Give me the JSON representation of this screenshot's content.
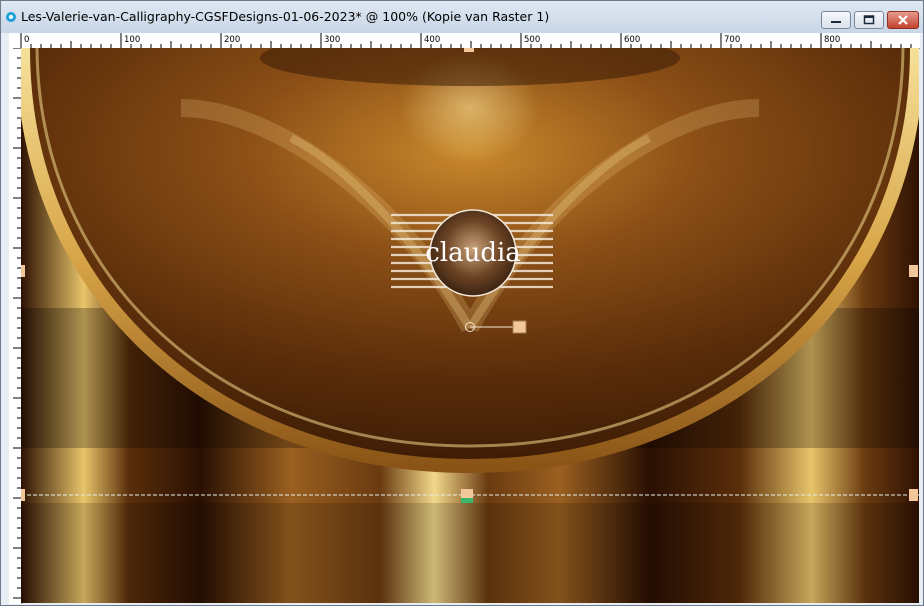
{
  "window": {
    "title": "Les-Valerie-van-Calligraphy-CGSFDesigns-01-06-2023* @ 100% (Kopie van Raster 1)"
  },
  "ruler": {
    "labels": [
      "0",
      "100",
      "200",
      "300",
      "400",
      "500",
      "600",
      "700",
      "800"
    ]
  },
  "watermark": {
    "name": "claudia"
  },
  "icons": {
    "app": "psp-app-icon",
    "minimize": "minimize-icon",
    "maximize": "maximize-icon",
    "close": "close-icon"
  },
  "colors": {
    "accent_gold": "#e8c46a",
    "dark_brown": "#3a1c05",
    "handle": "#f2c79a"
  }
}
